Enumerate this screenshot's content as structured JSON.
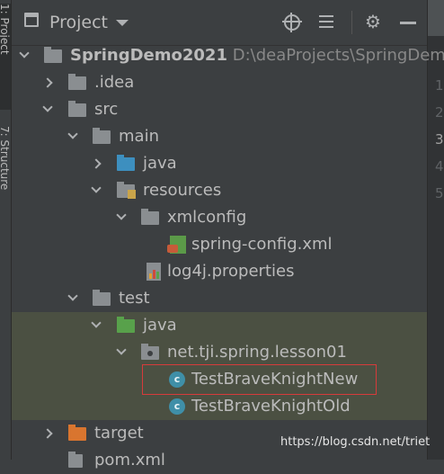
{
  "tool_strip": {
    "project_tab": "1: Project",
    "structure_tab": "7: Structure"
  },
  "header": {
    "title": "Project"
  },
  "editor": {
    "line_numbers": [
      "1",
      "2",
      "3",
      "4",
      "5"
    ]
  },
  "tree": {
    "root_name": "SpringDemo2021",
    "root_path": "D:\\deaProjects\\SpringDem",
    "idea": ".idea",
    "src": "src",
    "main": "main",
    "java_main": "java",
    "resources": "resources",
    "xmlconfig": "xmlconfig",
    "spring_config": "spring-config.xml",
    "log4j": "log4j.properties",
    "test": "test",
    "java_test": "java",
    "package": "net.tji.spring.lesson01",
    "class_new": "TestBraveKnightNew",
    "class_old": "TestBraveKnightOld",
    "target": "target",
    "pom": "pom.xml"
  },
  "class_icon_letter": "c",
  "watermark": "https://blog.csdn.net/triet",
  "colors": {
    "background": "#3c3f41",
    "selection": "#4b5042",
    "highlight_border": "#d63b3b",
    "source_folder": "#3d8fbf",
    "test_folder": "#58a14b",
    "excluded_folder": "#d9752f"
  }
}
